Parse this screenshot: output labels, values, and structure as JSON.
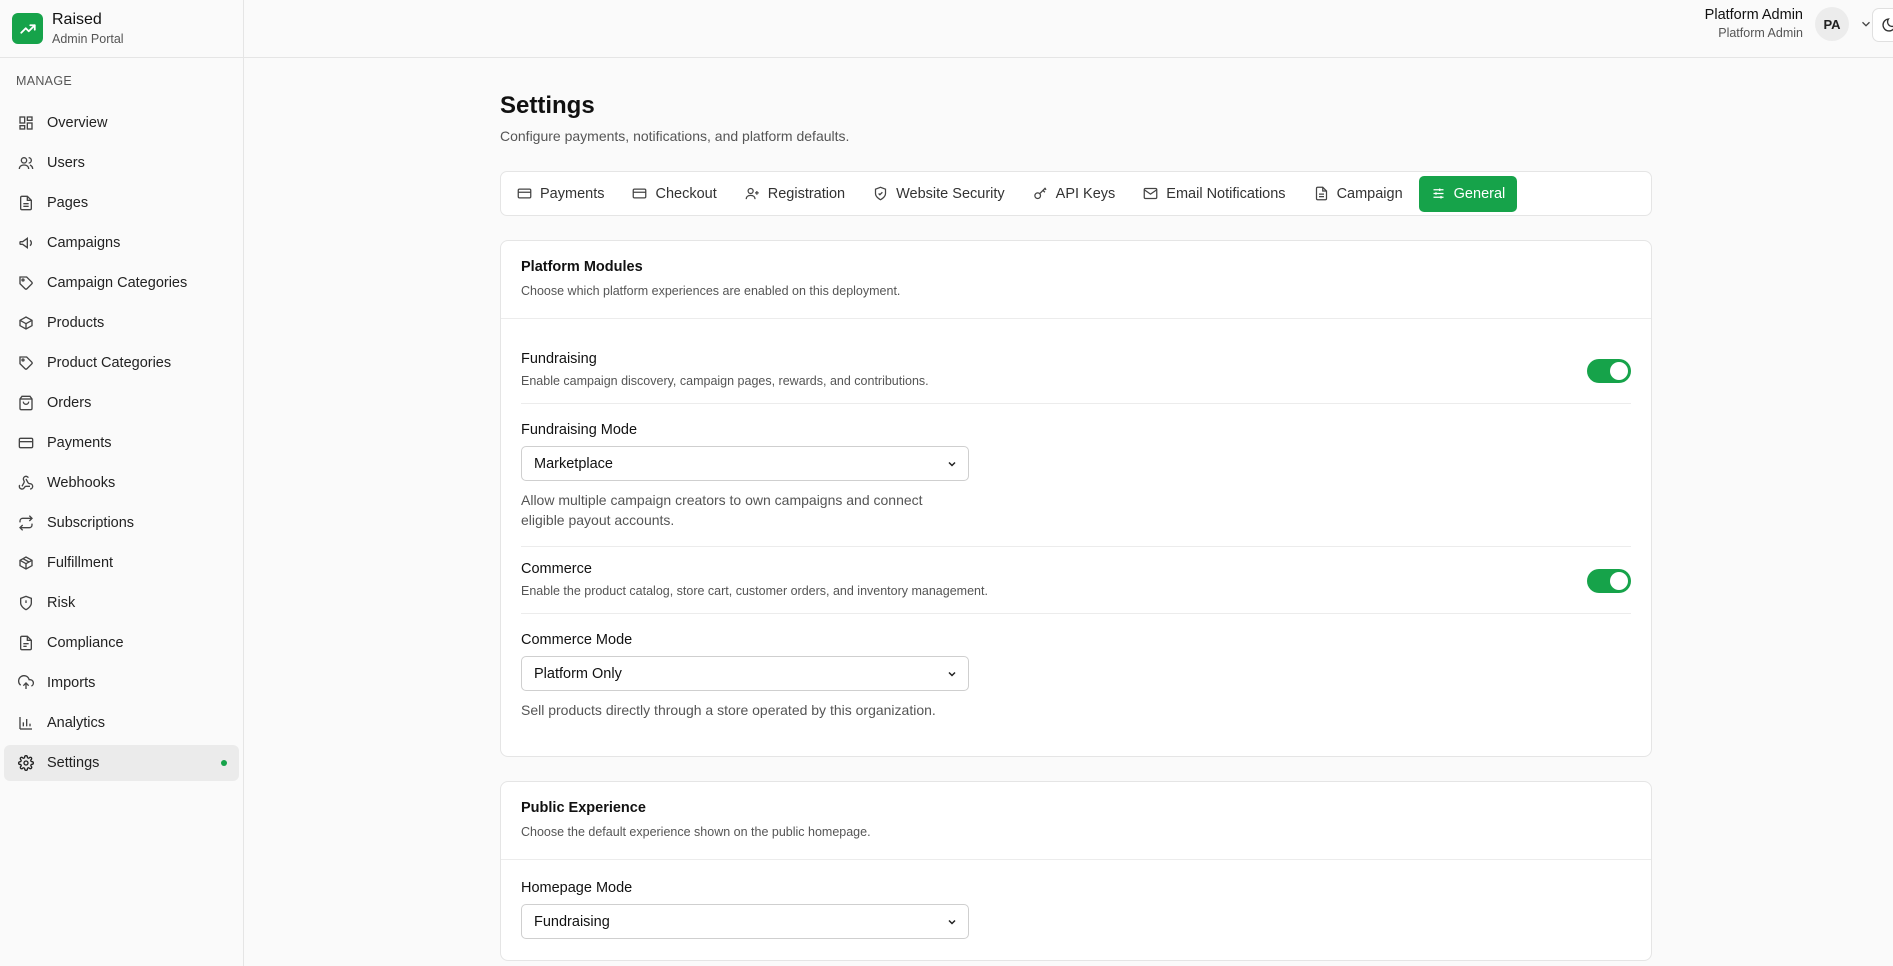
{
  "brand": {
    "name": "Raised",
    "subtitle": "Admin Portal"
  },
  "sidebar": {
    "section_label": "MANAGE",
    "items": [
      {
        "label": "Overview",
        "icon": "grid-icon"
      },
      {
        "label": "Users",
        "icon": "users-icon"
      },
      {
        "label": "Pages",
        "icon": "file-icon"
      },
      {
        "label": "Campaigns",
        "icon": "megaphone-icon"
      },
      {
        "label": "Campaign Categories",
        "icon": "tag-icon"
      },
      {
        "label": "Products",
        "icon": "package-icon"
      },
      {
        "label": "Product Categories",
        "icon": "tag-icon"
      },
      {
        "label": "Orders",
        "icon": "shopping-bag-icon"
      },
      {
        "label": "Payments",
        "icon": "credit-card-icon"
      },
      {
        "label": "Webhooks",
        "icon": "webhook-icon"
      },
      {
        "label": "Subscriptions",
        "icon": "repeat-icon"
      },
      {
        "label": "Fulfillment",
        "icon": "package-icon"
      },
      {
        "label": "Risk",
        "icon": "shield-icon"
      },
      {
        "label": "Compliance",
        "icon": "file-text-icon"
      },
      {
        "label": "Imports",
        "icon": "cloud-upload-icon"
      },
      {
        "label": "Analytics",
        "icon": "bar-chart-icon"
      },
      {
        "label": "Settings",
        "icon": "gear-icon",
        "active": true
      }
    ]
  },
  "header": {
    "user_name": "Platform Admin",
    "user_role": "Platform Admin",
    "avatar_initials": "PA"
  },
  "page": {
    "title": "Settings",
    "subtitle": "Configure payments, notifications, and platform defaults."
  },
  "tabs": [
    {
      "label": "Payments",
      "icon": "credit-card-icon"
    },
    {
      "label": "Checkout",
      "icon": "credit-card-icon"
    },
    {
      "label": "Registration",
      "icon": "user-plus-icon"
    },
    {
      "label": "Website Security",
      "icon": "shield-check-icon"
    },
    {
      "label": "API Keys",
      "icon": "key-icon"
    },
    {
      "label": "Email Notifications",
      "icon": "mail-icon"
    },
    {
      "label": "Campaign",
      "icon": "file-icon"
    },
    {
      "label": "General",
      "icon": "sliders-icon",
      "active": true
    }
  ],
  "modules": {
    "title": "Platform Modules",
    "description": "Choose which platform experiences are enabled on this deployment.",
    "fundraising": {
      "title": "Fundraising",
      "description": "Enable campaign discovery, campaign pages, rewards, and contributions.",
      "enabled": true,
      "mode_label": "Fundraising Mode",
      "mode_value": "Marketplace",
      "mode_help": "Allow multiple campaign creators to own campaigns and connect eligible payout accounts."
    },
    "commerce": {
      "title": "Commerce",
      "description": "Enable the product catalog, store cart, customer orders, and inventory management.",
      "enabled": true,
      "mode_label": "Commerce Mode",
      "mode_value": "Platform Only",
      "mode_help": "Sell products directly through a store operated by this organization."
    }
  },
  "public_experience": {
    "title": "Public Experience",
    "description": "Choose the default experience shown on the public homepage.",
    "homepage_label": "Homepage Mode",
    "homepage_value": "Fundraising"
  },
  "colors": {
    "accent": "#16a34a",
    "border": "#e5e5e5",
    "background": "#fafafa"
  }
}
